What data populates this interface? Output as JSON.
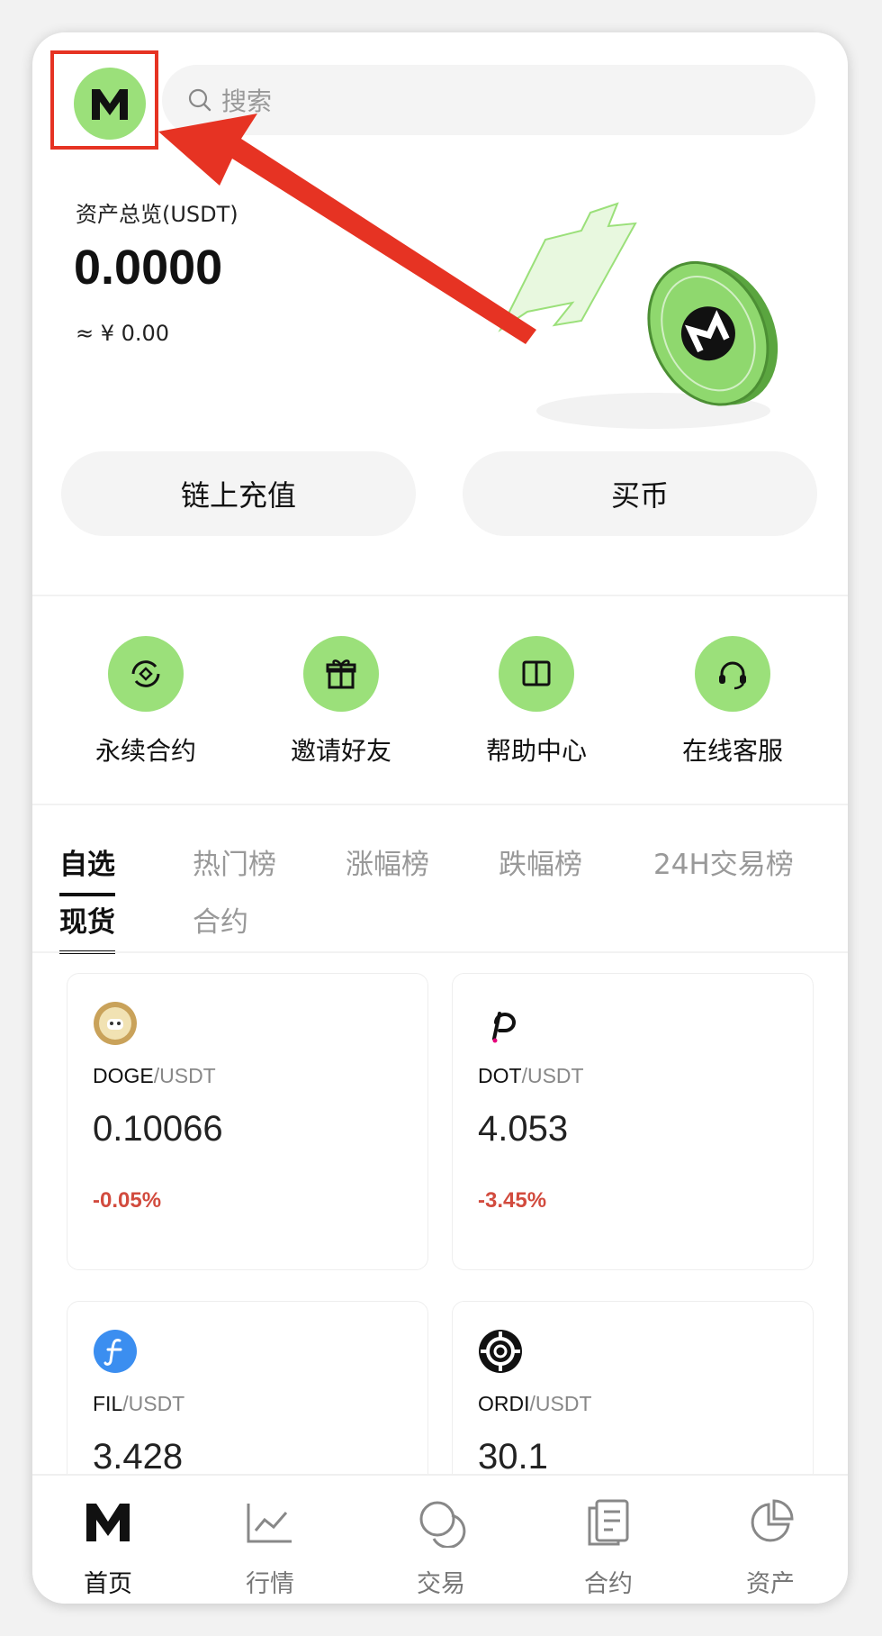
{
  "header": {
    "avatar_letter": "M",
    "search_placeholder": "搜索"
  },
  "assets": {
    "title": "资产总览(USDT)",
    "value": "0.0000",
    "cny": "≈ ¥ 0.00"
  },
  "actions": {
    "deposit_label": "链上充值",
    "buy_label": "买币"
  },
  "quick_links": [
    {
      "label": "永续合约",
      "icon": "perpetual-contract-icon"
    },
    {
      "label": "邀请好友",
      "icon": "gift-icon"
    },
    {
      "label": "帮助中心",
      "icon": "book-icon"
    },
    {
      "label": "在线客服",
      "icon": "headset-icon"
    }
  ],
  "market_tabs": [
    "自选",
    "热门榜",
    "涨幅榜",
    "跌幅榜",
    "24H交易榜"
  ],
  "sub_tabs": [
    "现货",
    "合约"
  ],
  "tickers": [
    {
      "base": "DOGE",
      "quote": "/USDT",
      "price": "0.10066",
      "change": "-0.05%",
      "icon": "doge-coin-icon"
    },
    {
      "base": "DOT",
      "quote": "/USDT",
      "price": "4.053",
      "change": "-3.45%",
      "icon": "polkadot-icon"
    },
    {
      "base": "FIL",
      "quote": "/USDT",
      "price": "3.428",
      "change": "",
      "icon": "filecoin-icon"
    },
    {
      "base": "ORDI",
      "quote": "/USDT",
      "price": "30.1",
      "change": "",
      "icon": "ordi-icon"
    }
  ],
  "bottom_nav": [
    {
      "label": "首页",
      "icon": "home-m-icon"
    },
    {
      "label": "行情",
      "icon": "chart-icon"
    },
    {
      "label": "交易",
      "icon": "trade-icon"
    },
    {
      "label": "合约",
      "icon": "contract-icon"
    },
    {
      "label": "资产",
      "icon": "pie-chart-icon"
    }
  ],
  "colors": {
    "accent_green": "#9be07a",
    "annotation_red": "#e63323",
    "negative_red": "#d24b3e"
  }
}
